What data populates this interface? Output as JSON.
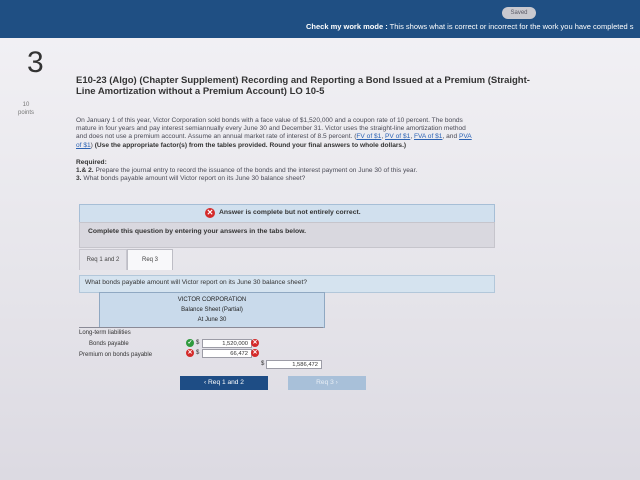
{
  "header": {
    "saved_label": "Saved",
    "mode_bold": "Check my work mode :",
    "mode_rest": " This shows what is correct or incorrect for the work you have completed s"
  },
  "question": {
    "number": "3",
    "points_value": "10",
    "points_label": "points",
    "title_line1": "E10-23 (Algo) (Chapter Supplement) Recording and Reporting a Bond Issued at a Premium (Straight-",
    "title_line2": "Line Amortization without a Premium Account) LO 10-5"
  },
  "body": {
    "line1": "On January 1 of this year, Victor Corporation sold bonds with a face value of $1,520,000 and a coupon rate of 10 percent. The bonds",
    "line2": "mature in four years and pay interest semiannually every June 30 and December 31. Victor uses the straight-line amortization method",
    "line3": "and does not use a premium account. Assume an annual market rate of interest of 8.5 percent.",
    "link_fv1": "FV of $1",
    "link_pv1": "PV of $1",
    "link_fva1": "FVA of $1",
    "and_text": "and",
    "link_pva": "PVA",
    "link_pva2": "of $1",
    "instruction": "(Use the appropriate factor(s) from the tables provided. Round your final answers to whole dollars.)"
  },
  "required": {
    "label": "Required:",
    "item1_num": "1.& 2.",
    "item1": "Prepare the journal entry to record the issuance of the bonds and the interest payment on June 30 of this year.",
    "item3_num": "3.",
    "item3": "What bonds payable amount will Victor report on its June 30 balance sheet?"
  },
  "banner": {
    "text": "Answer is complete but not entirely correct."
  },
  "panel": {
    "text": "Complete this question by entering your answers in the tabs below."
  },
  "tabs": [
    {
      "label": "Req 1 and 2"
    },
    {
      "label": "Req 3"
    }
  ],
  "prompt": "What bonds payable amount will Victor report on its June 30 balance sheet?",
  "balance_sheet": {
    "company": "VICTOR CORPORATION",
    "subtitle": "Balance Sheet (Partial)",
    "date": "At June 30",
    "section": "Long-term liabilities",
    "rows": [
      {
        "label": "Bonds payable",
        "dollar": "$",
        "value": "1,520,000",
        "status_left": "correct",
        "status_right": "incorrect"
      },
      {
        "label": "Premium on bonds payable",
        "dollar": "$",
        "value": "66,472",
        "status_left": "incorrect",
        "status_right": "incorrect"
      }
    ],
    "total_dollar": "$",
    "total": "1,586,472"
  },
  "nav": {
    "prev_label": "Req 1 and 2",
    "next_label": "Req 3"
  },
  "colors": {
    "header_bg": "#1f4f83",
    "correct": "#2f9a3e",
    "incorrect": "#d42a2a"
  }
}
